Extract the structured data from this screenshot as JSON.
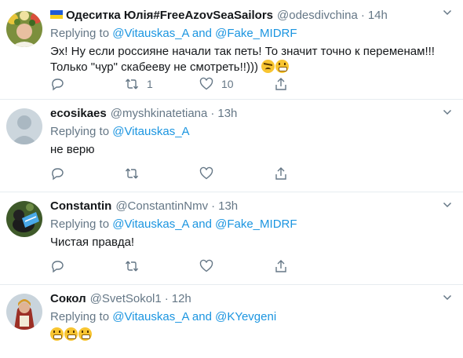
{
  "tweets": [
    {
      "name": "Одеситка Юлія#FreeAzovSeaSailors",
      "handle": "@odesdivchina",
      "time": "14h",
      "replying_label": "Replying to",
      "mention1": "@Vitauskas_A",
      "and": "and",
      "mention2": "@Fake_MIDRF",
      "line1": "Эх! Ну если россияне начали так петь! То значит точно к переменам!!!",
      "line2": "Только \"чур\" скабееву не смотреть!!)))",
      "retweets": "1",
      "likes": "10"
    },
    {
      "name": "ecosikaes",
      "handle": "@myshkinatetiana",
      "time": "13h",
      "replying_label": "Replying to",
      "mention1": "@Vitauskas_A",
      "text": "не верю"
    },
    {
      "name": "Constantin",
      "handle": "@ConstantinNmv",
      "time": "13h",
      "replying_label": "Replying to",
      "mention1": "@Vitauskas_A",
      "and": "and",
      "mention2": "@Fake_MIDRF",
      "text": "Чистая правда!"
    },
    {
      "name": "Сокол",
      "handle": "@SvetSokol1",
      "time": "12h",
      "replying_label": "Replying to",
      "mention1": "@Vitauskas_A",
      "and": "and",
      "mention2": "@KYevgeni"
    }
  ],
  "separator": "·",
  "icons": [
    "reply-icon",
    "retweet-icon",
    "like-icon",
    "share-icon",
    "chevron-down-icon",
    "ukraine-flag-icon",
    "grinning-emoji",
    "persevering-emoji"
  ],
  "colors": {
    "link": "#1b95e0",
    "muted": "#657786",
    "border": "#e6ecf0",
    "text": "#14171a"
  }
}
